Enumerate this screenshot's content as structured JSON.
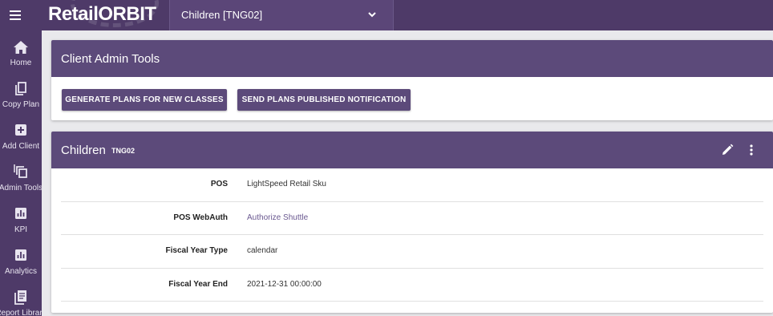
{
  "app": {
    "brand": "RetailORBIT"
  },
  "client_select": {
    "value": "Children [TNG02]"
  },
  "sidebar": {
    "items": [
      {
        "label": "Home",
        "icon": "home-icon"
      },
      {
        "label": "Copy Plan",
        "icon": "copy-icon"
      },
      {
        "label": "Add Client",
        "icon": "plus-box-icon"
      },
      {
        "label": "Admin Tools",
        "icon": "layers-icon"
      },
      {
        "label": "KPI",
        "icon": "bar-chart-icon"
      },
      {
        "label": "Analytics",
        "icon": "bar-chart-icon"
      },
      {
        "label": "Report Library",
        "icon": "library-icon"
      }
    ]
  },
  "admin_tools": {
    "title": "Client Admin Tools",
    "generate_label": "GENERATE PLANS FOR NEW CLASSES",
    "notify_label": "SEND PLANS PUBLISHED NOTIFICATION"
  },
  "client_card": {
    "title": "Children",
    "code": "TNG02",
    "rows": [
      {
        "key": "POS",
        "value": "LightSpeed Retail Sku"
      },
      {
        "key": "POS WebAuth",
        "value": "Authorize Shuttle"
      },
      {
        "key": "Fiscal Year Type",
        "value": "calendar"
      },
      {
        "key": "Fiscal Year End",
        "value": "2021-12-31 00:00:00"
      }
    ]
  },
  "colors": {
    "topbar": "#4e3a68",
    "card_header": "#5c4a7a",
    "link": "#6a5890"
  }
}
